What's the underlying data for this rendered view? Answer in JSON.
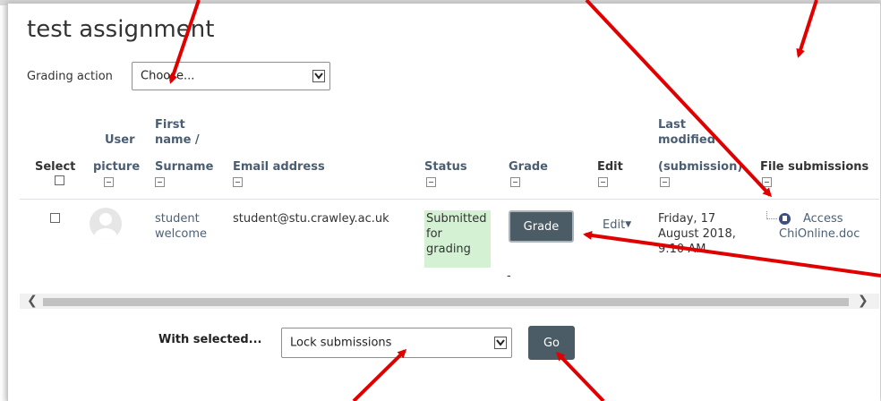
{
  "page": {
    "title": "test assignment"
  },
  "grading_action": {
    "label": "Grading action",
    "selected": "Choose..."
  },
  "table": {
    "headers": {
      "select": "Select",
      "user_picture": [
        "User",
        "picture"
      ],
      "name": [
        "First",
        "name /",
        "Surname"
      ],
      "email": "Email address",
      "status": "Status",
      "grade": "Grade",
      "edit": "Edit",
      "last_modified": [
        "Last",
        "modified",
        "(submission)"
      ],
      "file_submissions": "File submissions"
    },
    "row": {
      "name": [
        "student",
        "welcome"
      ],
      "email": "student@stu.crawley.ac.uk",
      "status": [
        "Submitted",
        "for",
        "grading"
      ],
      "grade_button": "Grade",
      "grade_value": "-",
      "edit": "Edit",
      "last_modified": [
        "Friday, 17",
        "August 2018,",
        "9:10 AM"
      ],
      "file": [
        "Access",
        "ChiOnline.doc"
      ]
    }
  },
  "bulk": {
    "label": "With selected...",
    "selected": "Lock submissions",
    "go_label": "Go"
  },
  "icons": [
    "chevron-down-icon",
    "collapse-icon",
    "user-avatar-icon",
    "file-icon",
    "scroll-left-icon",
    "scroll-right-icon"
  ],
  "annotation_color": "#e00000"
}
